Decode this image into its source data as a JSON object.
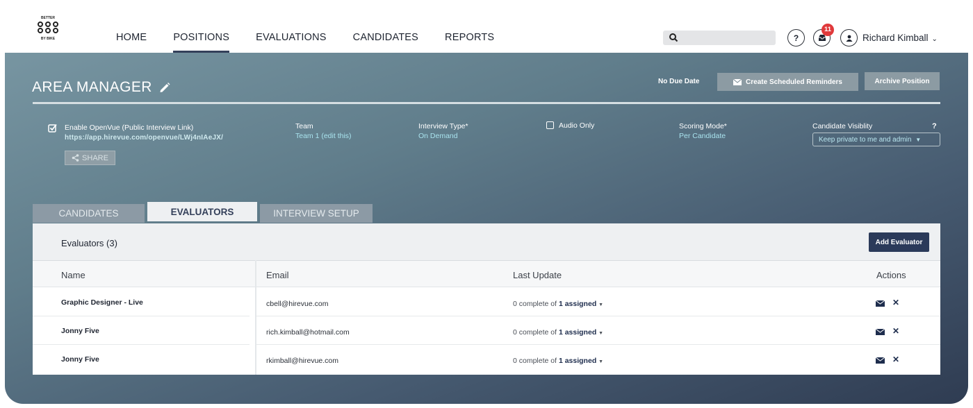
{
  "header": {
    "logo_text": "BETTER BY BIKE",
    "nav": [
      {
        "label": "HOME",
        "active": false
      },
      {
        "label": "POSITIONS",
        "active": true
      },
      {
        "label": "EVALUATIONS",
        "active": false
      },
      {
        "label": "CANDIDATES",
        "active": false
      },
      {
        "label": "REPORTS",
        "active": false
      }
    ],
    "search_placeholder": "",
    "help_label": "?",
    "notification_count": "11",
    "user_name": "Richard Kimball",
    "user_menu_icon": "chevron-down-icon"
  },
  "position": {
    "title": "AREA MANAGER",
    "due_date": "No Due Date",
    "reminders_button": "Create Scheduled Reminders",
    "archive_button": "Archive Position"
  },
  "settings": {
    "openvue_label": "Enable OpenVue (Public Interview Link)",
    "openvue_enabled": true,
    "openvue_link": "https://app.hirevue.com/openvue/LWj4nIAeJX/",
    "share_button": "SHARE",
    "team_label": "Team",
    "team_value": "Team 1 (edit this)",
    "interview_type_label": "Interview Type*",
    "interview_type_value": "On Demand",
    "audio_only_label": "Audio Only",
    "audio_only_checked": false,
    "scoring_mode_label": "Scoring Mode*",
    "scoring_mode_value": "Per Candidate",
    "visibility_label": "Candidate Visiblity",
    "visibility_help": "?",
    "visibility_value": "Keep private to me and admin"
  },
  "tabs": [
    {
      "label": "CANDIDATES",
      "active": false
    },
    {
      "label": "EVALUATORS",
      "active": true
    },
    {
      "label": "INTERVIEW SETUP",
      "active": false
    }
  ],
  "evaluators": {
    "heading": "Evaluators (3)",
    "add_button": "Add Evaluator",
    "columns": [
      "Name",
      "Email",
      "Last Update",
      "Actions"
    ],
    "rows": [
      {
        "name": "Graphic Designer - Live",
        "email": "cbell@hirevue.com",
        "complete_text": "0 complete of ",
        "assigned_text": "1 assigned"
      },
      {
        "name": "Jonny Five",
        "email": "rich.kimball@hotmail.com",
        "complete_text": "0 complete of ",
        "assigned_text": "1 assigned"
      },
      {
        "name": "Jonny Five",
        "email": "rkimball@hirevue.com",
        "complete_text": "0 complete of ",
        "assigned_text": "1 assigned"
      }
    ]
  },
  "colors": {
    "accent": "#2b3a5a",
    "link": "#a9e3ee",
    "badge": "#e0393b"
  }
}
